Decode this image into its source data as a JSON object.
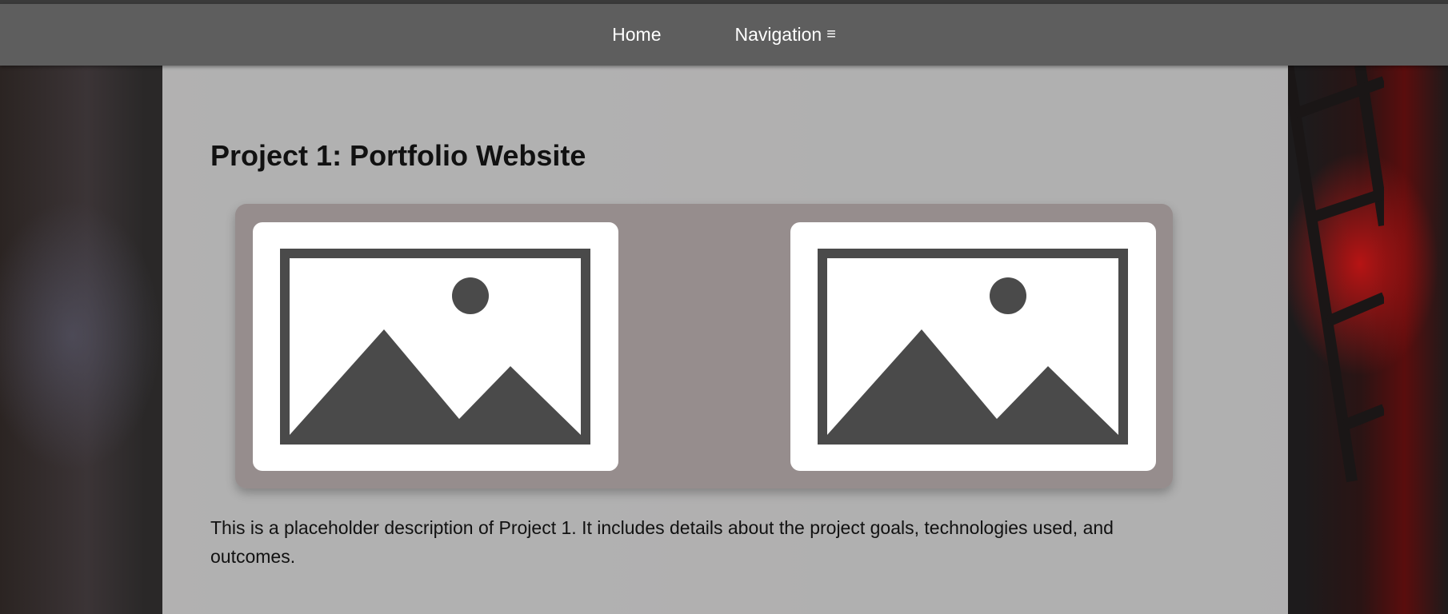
{
  "nav": {
    "home_label": "Home",
    "navigation_label": "Navigation",
    "navigation_icon": "≡"
  },
  "project": {
    "title": "Project 1: Portfolio Website",
    "images": [
      {
        "icon": "image-placeholder-icon"
      },
      {
        "icon": "image-placeholder-icon"
      }
    ],
    "description": "This is a placeholder description of Project 1. It includes details about the project goals, technologies used, and outcomes."
  },
  "colors": {
    "navbar": "#5e5e5e",
    "nav_text": "#ffffff",
    "placeholder_icon": "#4a4a4a"
  }
}
